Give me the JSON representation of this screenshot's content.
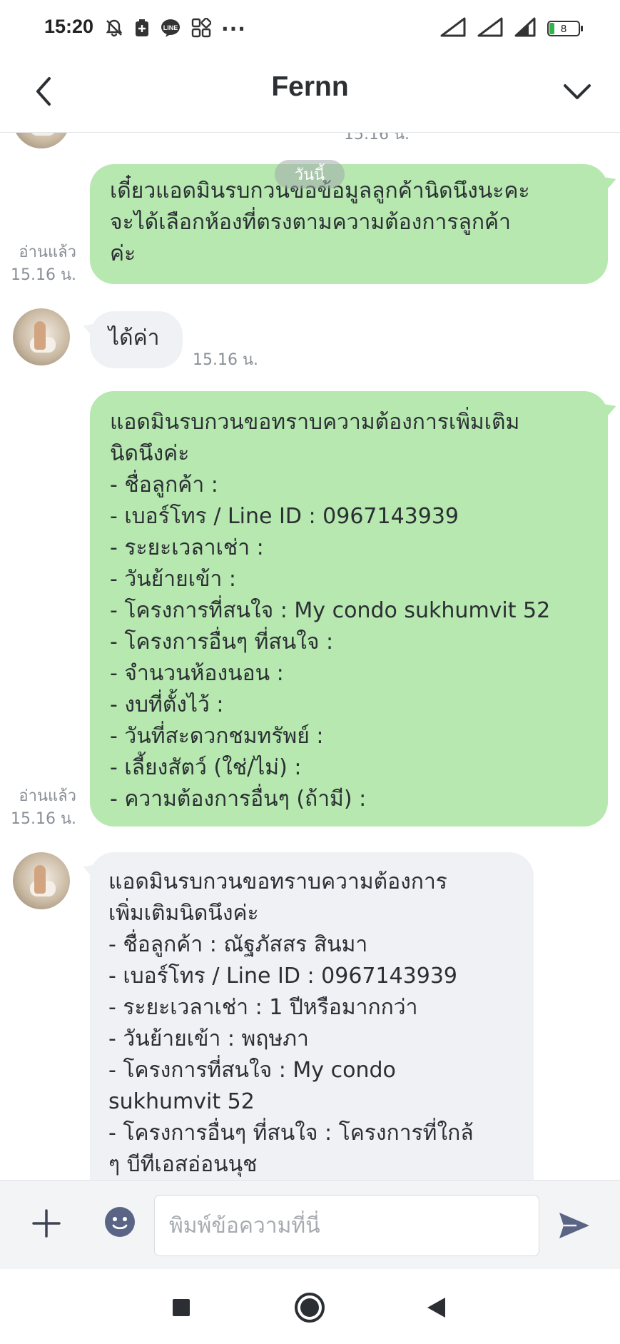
{
  "status_bar": {
    "time": "15:20",
    "overflow_indicator": "···",
    "battery_level": "8",
    "icons_left": [
      "bell-muted-icon",
      "battery-saver-icon",
      "line-app-icon",
      "widget-icon"
    ],
    "icons_right": [
      "signal-icon",
      "signal-icon",
      "signal-icon",
      "battery-icon"
    ]
  },
  "header": {
    "title": "Fernn",
    "back_icon": "chevron-left-icon",
    "menu_icon": "chevron-down-icon"
  },
  "chat": {
    "date_chip": "วันนี้",
    "clipped_time": "15.16 น.",
    "messages": [
      {
        "sender": "me",
        "text": "เดี๋ยวแอดมินรบกวนขอข้อมูลลูกค้านิดนึงนะคะ\nจะได้เลือกห้องที่ตรงตามความต้องการลูกค้า\nค่ะ",
        "read_label": "อ่านแล้ว",
        "time": "15.16 น."
      },
      {
        "sender": "them",
        "text": "ได้ค่า",
        "time": "15.16 น."
      },
      {
        "sender": "me",
        "text": "แอดมินรบกวนขอทราบความต้องการเพิ่มเติม\nนิดนึงค่ะ\n- ชื่อลูกค้า :\n- เบอร์โทร / Line ID : 0967143939\n- ระยะเวลาเช่า :\n- วันย้ายเข้า :\n- โครงการที่สนใจ : My condo sukhumvit 52\n- โครงการอื่นๆ ที่สนใจ :\n- จำนวนห้องนอน :\n- งบที่ตั้งไว้ :\n- วันที่สะดวกชมทรัพย์ :\n- เลี้ยงสัตว์ (ใช่/ไม่) :\n- ความต้องการอื่นๆ (ถ้ามี) :",
        "read_label": "อ่านแล้ว",
        "time": "15.16 น."
      },
      {
        "sender": "them",
        "text": "แอดมินรบกวนขอทราบความต้องการ\nเพิ่มเติมนิดนึงค่ะ\n- ชื่อลูกค้า : ณัฐภัสสร สินมา\n- เบอร์โทร / Line ID : 0967143939\n- ระยะเวลาเช่า : 1 ปีหรือมากกว่า\n- วันย้ายเข้า : พฤษภา\n- โครงการที่สนใจ : My condo\nsukhumvit 52\n- โครงการอื่นๆ ที่สนใจ : โครงการที่ใกล้\nๆ บีทีเอสอ่อนนุช"
      }
    ]
  },
  "input_bar": {
    "placeholder": "พิมพ์ข้อความที่นี่",
    "value": "",
    "plus_icon": "plus-icon",
    "emoji_icon": "emoji-icon",
    "send_icon": "send-icon"
  },
  "nav_bar": {
    "icons": [
      "recents-square-icon",
      "home-circle-icon",
      "back-triangle-icon"
    ]
  },
  "colors": {
    "my_bubble": "#b6e8b0",
    "their_bubble": "#f0f1f4",
    "meta_text": "#8a8f96"
  }
}
